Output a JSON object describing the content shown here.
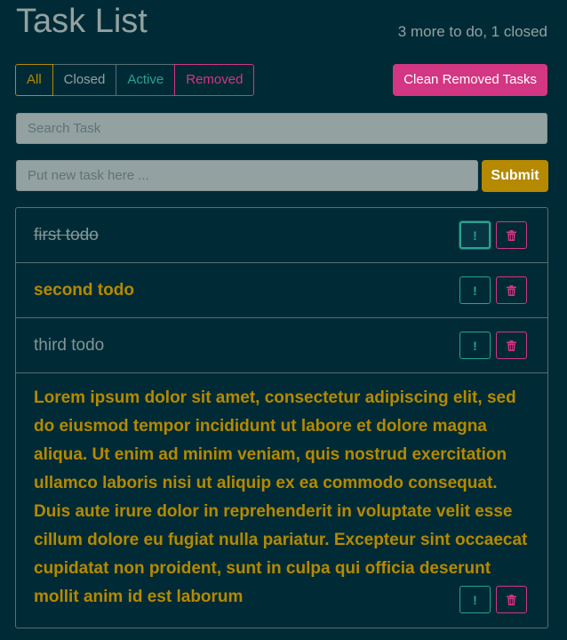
{
  "header": {
    "title": "Task List",
    "summary": "3 more to do, 1 closed"
  },
  "filters": {
    "all": "All",
    "closed": "Closed",
    "active": "Active",
    "removed": "Removed"
  },
  "clean_button": "Clean Removed Tasks",
  "search": {
    "placeholder": "Search Task",
    "value": ""
  },
  "new_task": {
    "placeholder": "Put new task here ...",
    "value": "",
    "submit_label": "Submit"
  },
  "tasks": [
    {
      "text": "first todo",
      "status": "closed"
    },
    {
      "text": "second todo",
      "status": "active"
    },
    {
      "text": "third todo",
      "status": "normal"
    },
    {
      "text": "Lorem ipsum dolor sit amet, consectetur adipiscing elit, sed do eiusmod tempor incididunt ut labore et dolore magna aliqua. Ut enim ad minim veniam, quis nostrud exercitation ullamco laboris nisi ut aliquip ex ea commodo consequat. Duis aute irure dolor in reprehenderit in voluptate velit esse cillum dolore eu fugiat nulla pariatur. Excepteur sint occaecat cupidatat non proident, sunt in culpa qui officia deserunt mollit anim id est laborum",
      "status": "active"
    }
  ],
  "icons": {
    "priority": "exclamation-icon",
    "delete": "trash-icon"
  },
  "colors": {
    "background": "#002b36",
    "yellow": "#b58900",
    "cyan": "#2aa198",
    "magenta": "#d33682",
    "text_muted": "#93a1a1"
  }
}
